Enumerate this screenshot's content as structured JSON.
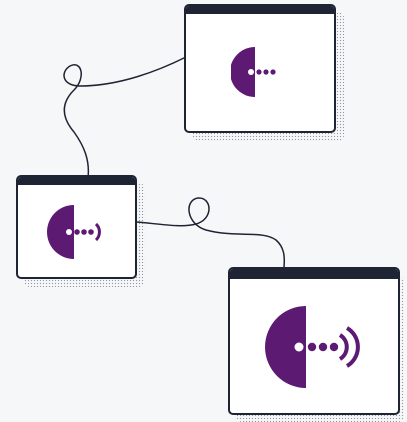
{
  "colors": {
    "background": "#f6f7f9",
    "window_frame": "#1e2433",
    "window_fill": "#ffffff",
    "brand_purple": "#5c1a73",
    "connector_line": "#1e2433"
  },
  "windows": [
    {
      "name": "top-right-window",
      "icon": "purple-logo-dots-icon"
    },
    {
      "name": "middle-left-window",
      "icon": "purple-logo-dots-signal-icon"
    },
    {
      "name": "bottom-right-window",
      "icon": "purple-logo-dots-signal-icon"
    }
  ]
}
